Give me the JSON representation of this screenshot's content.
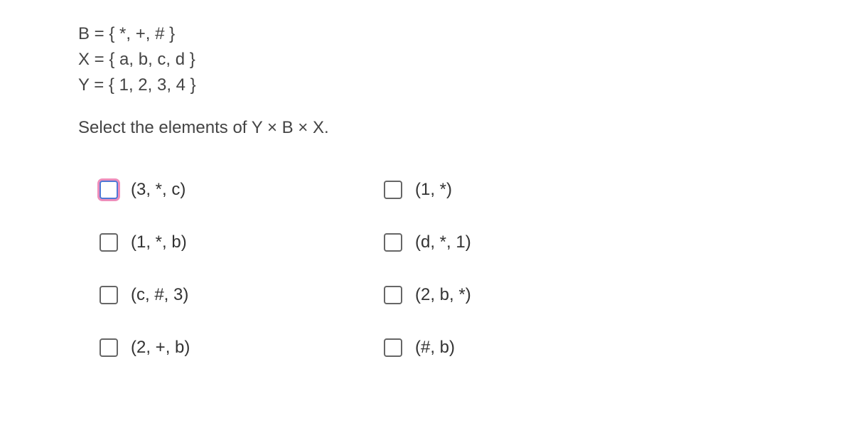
{
  "sets": {
    "line1": "B = { *, +, # }",
    "line2": "X = { a, b, c, d }",
    "line3": "Y = { 1, 2, 3, 4 }"
  },
  "prompt": "Select the elements of Y × B × X.",
  "options": [
    {
      "label": "(3, *, c)",
      "focused": true
    },
    {
      "label": "(1, *)",
      "focused": false
    },
    {
      "label": "(1, *, b)",
      "focused": false
    },
    {
      "label": "(d, *, 1)",
      "focused": false
    },
    {
      "label": "(c, #, 3)",
      "focused": false
    },
    {
      "label": "(2, b, *)",
      "focused": false
    },
    {
      "label": "(2, +, b)",
      "focused": false
    },
    {
      "label": "(#, b)",
      "focused": false
    }
  ]
}
